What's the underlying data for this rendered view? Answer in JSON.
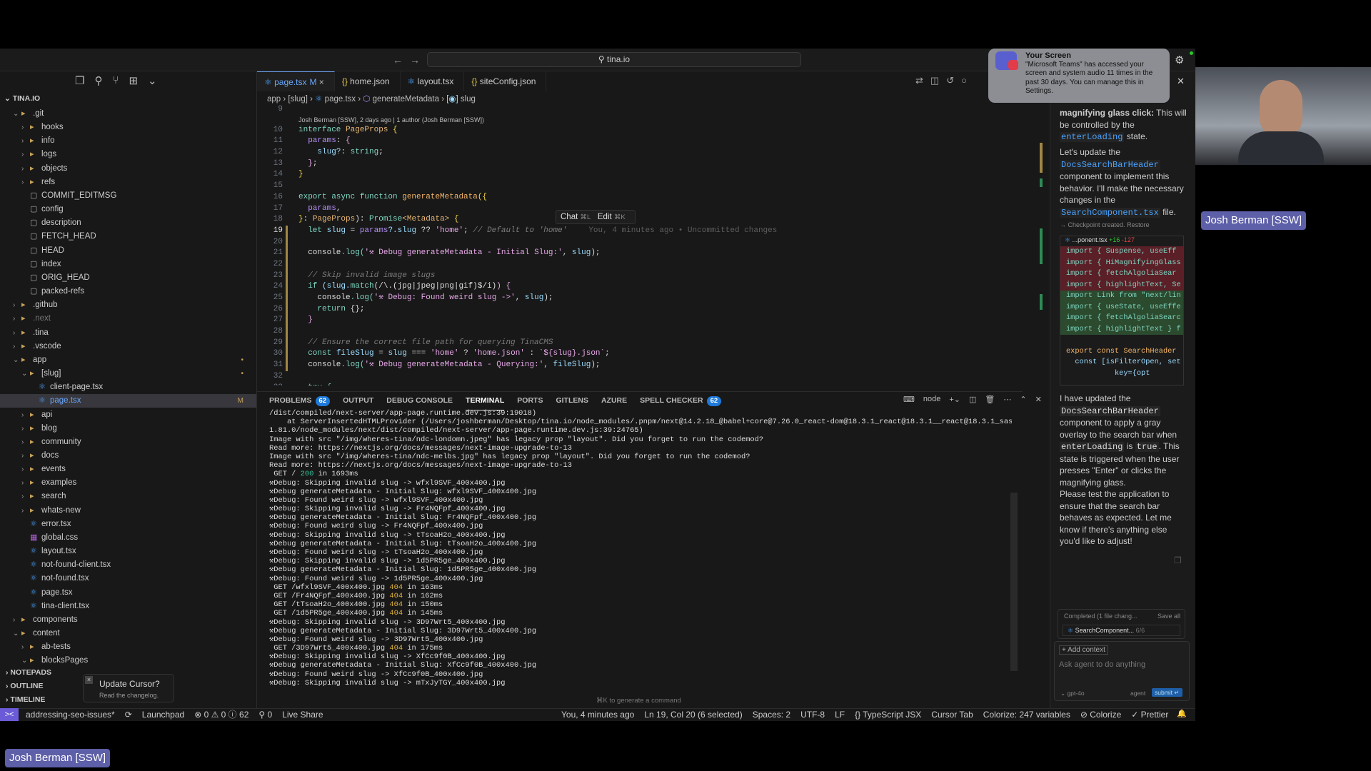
{
  "titlebar": {
    "search": "tina.io",
    "back": "←",
    "forward": "→"
  },
  "sidebar": {
    "root": "TINA.IO",
    "tree": [
      {
        "d": 1,
        "t": "folder",
        "open": true,
        "n": ".git"
      },
      {
        "d": 2,
        "t": "folder",
        "n": "hooks"
      },
      {
        "d": 2,
        "t": "folder",
        "n": "info"
      },
      {
        "d": 2,
        "t": "folder",
        "n": "logs"
      },
      {
        "d": 2,
        "t": "folder",
        "n": "objects"
      },
      {
        "d": 2,
        "t": "folder",
        "n": "refs"
      },
      {
        "d": 2,
        "t": "file",
        "n": "COMMIT_EDITMSG"
      },
      {
        "d": 2,
        "t": "file",
        "n": "config"
      },
      {
        "d": 2,
        "t": "file",
        "n": "description"
      },
      {
        "d": 2,
        "t": "file",
        "n": "FETCH_HEAD"
      },
      {
        "d": 2,
        "t": "file",
        "n": "HEAD"
      },
      {
        "d": 2,
        "t": "file",
        "n": "index"
      },
      {
        "d": 2,
        "t": "file",
        "n": "ORIG_HEAD"
      },
      {
        "d": 2,
        "t": "file",
        "n": "packed-refs"
      },
      {
        "d": 1,
        "t": "folder",
        "n": ".github"
      },
      {
        "d": 1,
        "t": "folder",
        "n": ".next",
        "dim": true
      },
      {
        "d": 1,
        "t": "folder",
        "n": ".tina"
      },
      {
        "d": 1,
        "t": "folder",
        "n": ".vscode"
      },
      {
        "d": 1,
        "t": "folder",
        "open": true,
        "n": "app",
        "mod": "•"
      },
      {
        "d": 2,
        "t": "folder",
        "open": true,
        "n": "[slug]",
        "mod": "•"
      },
      {
        "d": 3,
        "t": "tsx",
        "n": "client-page.tsx"
      },
      {
        "d": 3,
        "t": "tsx",
        "n": "page.tsx",
        "sel": true,
        "mod": "M"
      },
      {
        "d": 2,
        "t": "folder",
        "n": "api"
      },
      {
        "d": 2,
        "t": "folder",
        "n": "blog"
      },
      {
        "d": 2,
        "t": "folder",
        "n": "community"
      },
      {
        "d": 2,
        "t": "folder",
        "n": "docs"
      },
      {
        "d": 2,
        "t": "folder",
        "n": "events"
      },
      {
        "d": 2,
        "t": "folder",
        "n": "examples"
      },
      {
        "d": 2,
        "t": "folder",
        "n": "search"
      },
      {
        "d": 2,
        "t": "folder",
        "n": "whats-new"
      },
      {
        "d": 2,
        "t": "tsx",
        "n": "error.tsx"
      },
      {
        "d": 2,
        "t": "css",
        "n": "global.css"
      },
      {
        "d": 2,
        "t": "tsx",
        "n": "layout.tsx"
      },
      {
        "d": 2,
        "t": "tsx",
        "n": "not-found-client.tsx"
      },
      {
        "d": 2,
        "t": "tsx",
        "n": "not-found.tsx"
      },
      {
        "d": 2,
        "t": "tsx",
        "n": "page.tsx"
      },
      {
        "d": 2,
        "t": "tsx",
        "n": "tina-client.tsx"
      },
      {
        "d": 1,
        "t": "folder",
        "n": "components"
      },
      {
        "d": 1,
        "t": "folder",
        "open": true,
        "n": "content"
      },
      {
        "d": 2,
        "t": "folder",
        "n": "ab-tests"
      },
      {
        "d": 2,
        "t": "folder",
        "open": true,
        "n": "blocksPages"
      }
    ],
    "sections": [
      "NOTEPADS",
      "OUTLINE",
      "TIMELINE"
    ]
  },
  "toast": {
    "title": "Update Cursor?",
    "body": "Read the changelog."
  },
  "tabs": [
    {
      "label": "page.tsx",
      "mod": "M",
      "icon": "react",
      "active": true
    },
    {
      "label": "home.json",
      "icon": "json"
    },
    {
      "label": "layout.tsx",
      "icon": "react"
    },
    {
      "label": "siteConfig.json",
      "icon": "json"
    }
  ],
  "breadcrumb": [
    "app",
    "[slug]",
    "page.tsx",
    "generateMetadata",
    "slug"
  ],
  "editor": {
    "blame": "Josh Berman [SSW], 2 days ago | 1 author (Josh Berman [SSW])",
    "inline_blame": "You, 4 minutes ago • Uncommitted changes",
    "chat_label": "Chat",
    "chat_key": "⌘L",
    "edit_label": "Edit",
    "edit_key": "⌘K",
    "current_line": 19,
    "lines": [
      {
        "n": 9,
        "t": []
      },
      {
        "n": 10,
        "t": [
          [
            "interface ",
            "kw"
          ],
          [
            "PageProps ",
            "ty"
          ],
          [
            "{",
            "pu"
          ]
        ]
      },
      {
        "n": 11,
        "t": [
          [
            "  params",
            "pr"
          ],
          [
            ": ",
            "pl"
          ],
          [
            "{",
            "st"
          ]
        ]
      },
      {
        "n": 12,
        "t": [
          [
            "    slug?",
            "va"
          ],
          [
            ": ",
            "pl"
          ],
          [
            "string",
            "kw"
          ],
          [
            ";",
            "pl"
          ]
        ]
      },
      {
        "n": 13,
        "t": [
          [
            "  }",
            "st"
          ],
          [
            ";",
            "pl"
          ]
        ]
      },
      {
        "n": 14,
        "t": [
          [
            "}",
            "pu"
          ]
        ]
      },
      {
        "n": 15,
        "t": []
      },
      {
        "n": 16,
        "t": [
          [
            "export async function ",
            "kw"
          ],
          [
            "generateMetadata",
            "fn"
          ],
          [
            "({",
            "pu"
          ]
        ]
      },
      {
        "n": 17,
        "t": [
          [
            "  params",
            "pr"
          ],
          [
            ",",
            "pl"
          ]
        ]
      },
      {
        "n": 18,
        "t": [
          [
            "}",
            "pu"
          ],
          [
            ": ",
            "pl"
          ],
          [
            "PageProps",
            "ty"
          ],
          [
            "): ",
            "pl"
          ],
          [
            "Promise",
            "kw"
          ],
          [
            "<Metadata>",
            "ty"
          ],
          [
            " {",
            "pu"
          ]
        ]
      },
      {
        "n": 19,
        "t": [
          [
            "  let ",
            "kw"
          ],
          [
            "slug ",
            "va"
          ],
          [
            "= ",
            "pl"
          ],
          [
            "params",
            "pr"
          ],
          [
            "?.slug ",
            "va"
          ],
          [
            "?? ",
            "pl"
          ],
          [
            "'home'",
            "st"
          ],
          [
            "; ",
            "pl"
          ],
          [
            "// Default to 'home'",
            "cm"
          ]
        ]
      },
      {
        "n": 20,
        "t": []
      },
      {
        "n": 21,
        "t": [
          [
            "  console",
            "pl"
          ],
          [
            ".log(",
            "kw"
          ],
          [
            "'⚒ Debug generateMetadata - Initial Slug:'",
            "st"
          ],
          [
            ", ",
            "pl"
          ],
          [
            "slug",
            "va"
          ],
          [
            ");",
            "pl"
          ]
        ]
      },
      {
        "n": 22,
        "t": []
      },
      {
        "n": 23,
        "t": [
          [
            "  // Skip invalid image slugs",
            "cm"
          ]
        ]
      },
      {
        "n": 24,
        "t": [
          [
            "  if ",
            "kw"
          ],
          [
            "(slug.",
            "va"
          ],
          [
            "match",
            "kw"
          ],
          [
            "(/\\.(jpg|jpeg|png|gif)$/i)",
            "pl"
          ],
          [
            ") {",
            "st"
          ]
        ]
      },
      {
        "n": 25,
        "t": [
          [
            "    console",
            "pl"
          ],
          [
            ".log(",
            "kw"
          ],
          [
            "'⚒ Debug: Found weird slug ->'",
            "st"
          ],
          [
            ", ",
            "pl"
          ],
          [
            "slug",
            "va"
          ],
          [
            ");",
            "pl"
          ]
        ]
      },
      {
        "n": 26,
        "t": [
          [
            "    return ",
            "kw"
          ],
          [
            "{};",
            "pl"
          ]
        ]
      },
      {
        "n": 27,
        "t": [
          [
            "  }",
            "st"
          ]
        ]
      },
      {
        "n": 28,
        "t": []
      },
      {
        "n": 29,
        "t": [
          [
            "  // Ensure the correct file path for querying TinaCMS",
            "cm"
          ]
        ]
      },
      {
        "n": 30,
        "t": [
          [
            "  const ",
            "kw"
          ],
          [
            "fileSlug ",
            "va"
          ],
          [
            "= ",
            "pl"
          ],
          [
            "slug ",
            "va"
          ],
          [
            "=== ",
            "pl"
          ],
          [
            "'home' ",
            "st"
          ],
          [
            "? ",
            "pl"
          ],
          [
            "'home.json' ",
            "st"
          ],
          [
            ": ",
            "pl"
          ],
          [
            "`${slug}.json`",
            "st"
          ],
          [
            ";",
            "pl"
          ]
        ]
      },
      {
        "n": 31,
        "t": [
          [
            "  console",
            "pl"
          ],
          [
            ".log(",
            "kw"
          ],
          [
            "'⚒ Debug generateMetadata - Querying:'",
            "st"
          ],
          [
            ", ",
            "pl"
          ],
          [
            "fileSlug",
            "va"
          ],
          [
            ");",
            "pl"
          ]
        ]
      },
      {
        "n": 32,
        "t": []
      },
      {
        "n": 33,
        "t": [
          [
            "  try {",
            "kw"
          ]
        ]
      }
    ]
  },
  "panel": {
    "tabs": [
      {
        "label": "PROBLEMS",
        "badge": "62"
      },
      {
        "label": "OUTPUT"
      },
      {
        "label": "DEBUG CONSOLE"
      },
      {
        "label": "TERMINAL",
        "active": true
      },
      {
        "label": "PORTS"
      },
      {
        "label": "GITLENS"
      },
      {
        "label": "AZURE"
      },
      {
        "label": "SPELL CHECKER",
        "badge": "62"
      }
    ],
    "shell": "node",
    "generate_hint": "⌘K to generate a command",
    "terminal": [
      "/dist/compiled/next-server/app-page.runtime.dev.js:39:19018)",
      "    at ServerInsertedHTMLProvider (/Users/joshberman/Desktop/tina.io/node_modules/.pnpm/next@14.2.18_@babel+core@7.26.0_react-dom@18.3.1_react@18.3.1__react@18.3.1_sass@",
      "1.81.0/node_modules/next/dist/compiled/next-server/app-page.runtime.dev.js:39:24765)",
      "Image with src \"/img/wheres-tina/ndc-londomn.jpeg\" has legacy prop \"layout\". Did you forget to run the codemod?",
      "Read more: https://nextjs.org/docs/messages/next-image-upgrade-to-13",
      "Image with src \"/img/wheres-tina/ndc-melbs.jpg\" has legacy prop \"layout\". Did you forget to run the codemod?",
      "Read more: https://nextjs.org/docs/messages/next-image-upgrade-to-13",
      " GET / 200 in 1693ms",
      "⚒Debug: Skipping invalid slug -> wfxl9SVF_400x400.jpg",
      "⚒Debug generateMetadata - Initial Slug: wfxl9SVF_400x400.jpg",
      "⚒Debug: Found weird slug -> wfxl9SVF_400x400.jpg",
      "⚒Debug: Skipping invalid slug -> Fr4NQFpf_400x400.jpg",
      "⚒Debug generateMetadata - Initial Slug: Fr4NQFpf_400x400.jpg",
      "⚒Debug: Found weird slug -> Fr4NQFpf_400x400.jpg",
      "⚒Debug: Skipping invalid slug -> tTsoaH2o_400x400.jpg",
      "⚒Debug generateMetadata - Initial Slug: tTsoaH2o_400x400.jpg",
      "⚒Debug: Found weird slug -> tTsoaH2o_400x400.jpg",
      "⚒Debug: Skipping invalid slug -> 1d5PR5ge_400x400.jpg",
      "⚒Debug generateMetadata - Initial Slug: 1d5PR5ge_400x400.jpg",
      "⚒Debug: Found weird slug -> 1d5PR5ge_400x400.jpg",
      " GET /wfxl9SVF_400x400.jpg 404 in 163ms",
      " GET /Fr4NQFpf_400x400.jpg 404 in 162ms",
      " GET /tTsoaH2o_400x400.jpg 404 in 150ms",
      " GET /1d5PR5ge_400x400.jpg 404 in 145ms",
      "⚒Debug: Skipping invalid slug -> 3D97Wrt5_400x400.jpg",
      "⚒Debug generateMetadata - Initial Slug: 3D97Wrt5_400x400.jpg",
      "⚒Debug: Found weird slug -> 3D97Wrt5_400x400.jpg",
      " GET /3D97Wrt5_400x400.jpg 404 in 175ms",
      "⚒Debug: Skipping invalid slug -> XfCc9f0B_400x400.jpg",
      "⚒Debug generateMetadata - Initial Slug: XfCc9f0B_400x400.jpg",
      "⚒Debug: Found weird slug -> XfCc9f0B_400x400.jpg",
      "⚒Debug: Skipping invalid slug -> mTxJyTGY_400x400.jpg"
    ]
  },
  "statusbar": {
    "left": [
      "addressing-seo-issues*",
      "⟳",
      "Launchpad",
      "⊗ 0 ⚠ 0 ⓘ 62",
      "⚲ 0",
      "Live Share"
    ],
    "right": [
      "You, 4 minutes ago",
      "Ln 19, Col 20 (6 selected)",
      "Spaces: 2",
      "UTF-8",
      "LF",
      "{} TypeScript JSX",
      "Cursor Tab",
      "Colorize: 247 variables",
      "⊘ Colorize",
      "✓ Prettier"
    ]
  },
  "chat": {
    "p1": [
      [
        "magnifying glass click:",
        ""
      ],
      [
        " This will be controlled by the ",
        ""
      ],
      [
        "enterLoading",
        "c"
      ],
      [
        " state.",
        ""
      ]
    ],
    "p2": [
      [
        "Let's update the ",
        ""
      ],
      [
        "DocsSearchBarHeader",
        "c"
      ],
      [
        " component to implement this behavior. I'll make the necessary changes in the ",
        ""
      ],
      [
        "SearchComponent.tsx",
        "c"
      ],
      [
        " file.",
        ""
      ]
    ],
    "checkpoint": "→ Checkpoint created.",
    "restore": "Restore",
    "diff_file": "...ponent.tsx",
    "diff_add": "+16",
    "diff_del": "-127",
    "diff": [
      [
        "import { Suspense, useEff",
        "del"
      ],
      [
        "import { HiMagnifyingGlass",
        "del"
      ],
      [
        "import { fetchAlgoliaSear",
        "del"
      ],
      [
        "import { highlightText, Se",
        "del"
      ],
      [
        "import Link from \"next/lin",
        "add"
      ],
      [
        "import { useState, useEffe",
        "add"
      ],
      [
        "import { fetchAlgoliaSearc",
        "add"
      ],
      [
        "import { highlightText } f",
        "add"
      ],
      [
        "",
        ""
      ],
      [
        "export const SearchHeader",
        ""
      ],
      [
        "  const [isFilterOpen, set",
        ""
      ],
      [
        "           key={opt",
        ""
      ]
    ],
    "p3": [
      [
        "I have updated the ",
        ""
      ],
      [
        "DocsSearchBarHeader",
        "w"
      ],
      [
        " component to apply a gray overlay to the search bar when ",
        ""
      ],
      [
        "enterLoading",
        "w"
      ],
      [
        " is ",
        ""
      ],
      [
        "true",
        "w"
      ],
      [
        ". This state is triggered when the user presses \"Enter\" or clicks the magnifying glass.",
        ""
      ]
    ],
    "p4": "Please test the application to ensure that the search bar behaves as expected. Let me know if there's anything else you'd like to adjust!",
    "completed": "Completed (1 file chang...",
    "save_all": "Save all",
    "file": "SearchComponent...",
    "file_count": "6/6",
    "add_context": "+ Add context",
    "placeholder": "Ask agent to do anything",
    "model": "gpt-4o",
    "mode": "agent",
    "submit": "submit ↵"
  },
  "notification": {
    "title": "Your Screen",
    "body": "\"Microsoft Teams\" has accessed your screen and system audio 11 times in the past 30 days. You can manage this in Settings."
  },
  "participant": {
    "name": "Josh Berman [SSW]"
  },
  "colors": {
    "accent": "#6aa6f8",
    "badge": "#1e7ad9",
    "remote": "#6b5bd6",
    "nametag": "#5d5fa8"
  }
}
